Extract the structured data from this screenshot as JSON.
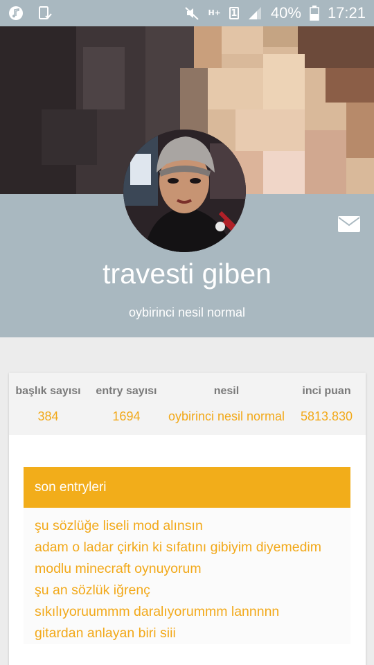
{
  "status_bar": {
    "left_icons": [
      "music-note-icon",
      "screenshot-check-icon"
    ],
    "network_label": "H+",
    "sim_label": "1",
    "battery_percent": "40%",
    "time": "17:21"
  },
  "profile": {
    "username": "travesti giben",
    "tagline": "oybirinci nesil normal",
    "mail_icon": "envelope-icon"
  },
  "stats": [
    {
      "label": "başlık sayısı",
      "value": "384"
    },
    {
      "label": "entry sayısı",
      "value": "1694"
    },
    {
      "label": "nesil",
      "value": "oybirinci nesil normal"
    },
    {
      "label": "inci puan",
      "value": "5813.830"
    }
  ],
  "entries": {
    "title": "son entryleri",
    "items": [
      "şu sözlüğe liseli mod alınsın",
      "adam o ladar çirkin ki sıfatını gibiyim diyemedim",
      "modlu minecraft oynuyorum",
      "şu an sözlük iğrenç",
      "sıkılıyoruummm daralıyorummm lannnnn",
      "gitardan anlayan biri siii"
    ]
  },
  "colors": {
    "header_band": "#a9b8c0",
    "accent": "#f2ad1a",
    "stat_label": "#7a7a7a"
  }
}
